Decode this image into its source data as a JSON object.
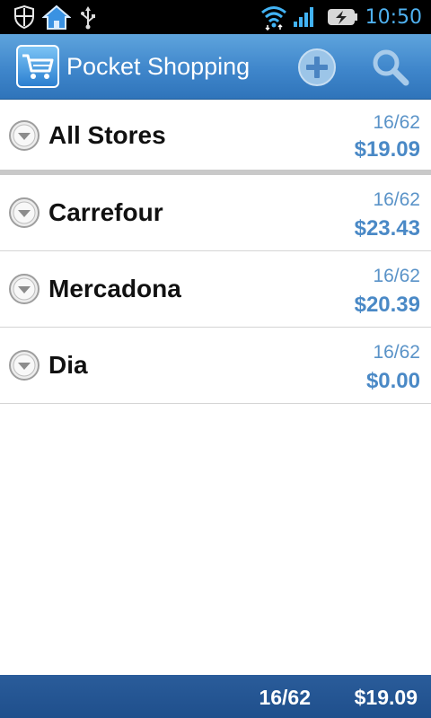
{
  "status_bar": {
    "time": "10:50",
    "icons": [
      "shield-icon",
      "home-icon",
      "usb-icon",
      "wifi-icon",
      "signal-icon",
      "battery-charging-icon"
    ]
  },
  "action_bar": {
    "title": "Pocket Shopping",
    "logo_icon": "shopping-cart-icon",
    "buttons": [
      "add-icon",
      "search-icon"
    ]
  },
  "stores": [
    {
      "name": "All Stores",
      "count": "16/62",
      "amount": "$19.09"
    },
    {
      "name": "Carrefour",
      "count": "16/62",
      "amount": "$23.43"
    },
    {
      "name": "Mercadona",
      "count": "16/62",
      "amount": "$20.39"
    },
    {
      "name": "Dia",
      "count": "16/62",
      "amount": "$0.00"
    }
  ],
  "footer": {
    "count": "16/62",
    "total": "$19.09"
  },
  "colors": {
    "action_bar": "#3f86cb",
    "accent_text": "#4a89c6",
    "footer": "#234f8c"
  }
}
